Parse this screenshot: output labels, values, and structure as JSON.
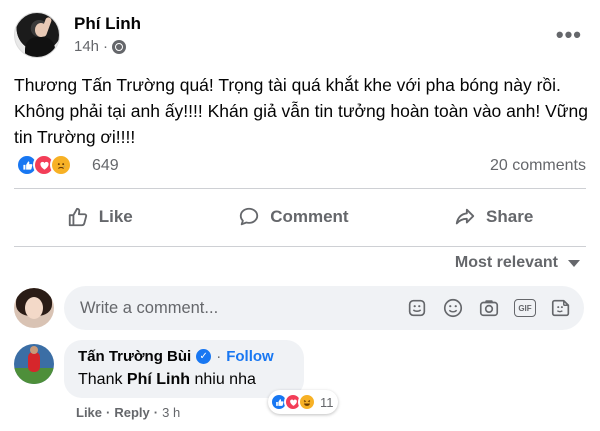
{
  "post": {
    "author": "Phí Linh",
    "time": "14h",
    "text": "Thương Tấn Trường quá! Trọng tài quá khắt khe với pha bóng này rồi. Không phải tại anh ấy!!!! Khán giả vẫn tin tưởng hoàn toàn vào anh! Vững tin Trường ơi!!!!",
    "reaction_count": "649",
    "comments_count": "20 comments",
    "reactions": [
      "like-icon",
      "love-icon",
      "sad-icon"
    ]
  },
  "actions": {
    "like": "Like",
    "comment": "Comment",
    "share": "Share"
  },
  "comments_section": {
    "sort_label": "Most relevant",
    "composer_placeholder": "Write a comment...",
    "composer_icons": [
      "sticker-icon",
      "emoji-icon",
      "camera-icon",
      "gif-icon",
      "sticker-face-icon"
    ],
    "gif_label": "GIF"
  },
  "reply": {
    "author": "Tấn Trường Bùi",
    "follow_label": "Follow",
    "text_prefix": "Thank ",
    "text_mention": "Phí Linh",
    "text_suffix": " nhiu nha",
    "reaction_count": "11",
    "like_label": "Like",
    "reply_label": "Reply",
    "time": "3 h"
  },
  "colors": {
    "accent": "#1877f2",
    "love": "#f33e58",
    "sad": "#f7b125",
    "secondary_text": "#65676b",
    "bubble": "#f0f2f5"
  }
}
